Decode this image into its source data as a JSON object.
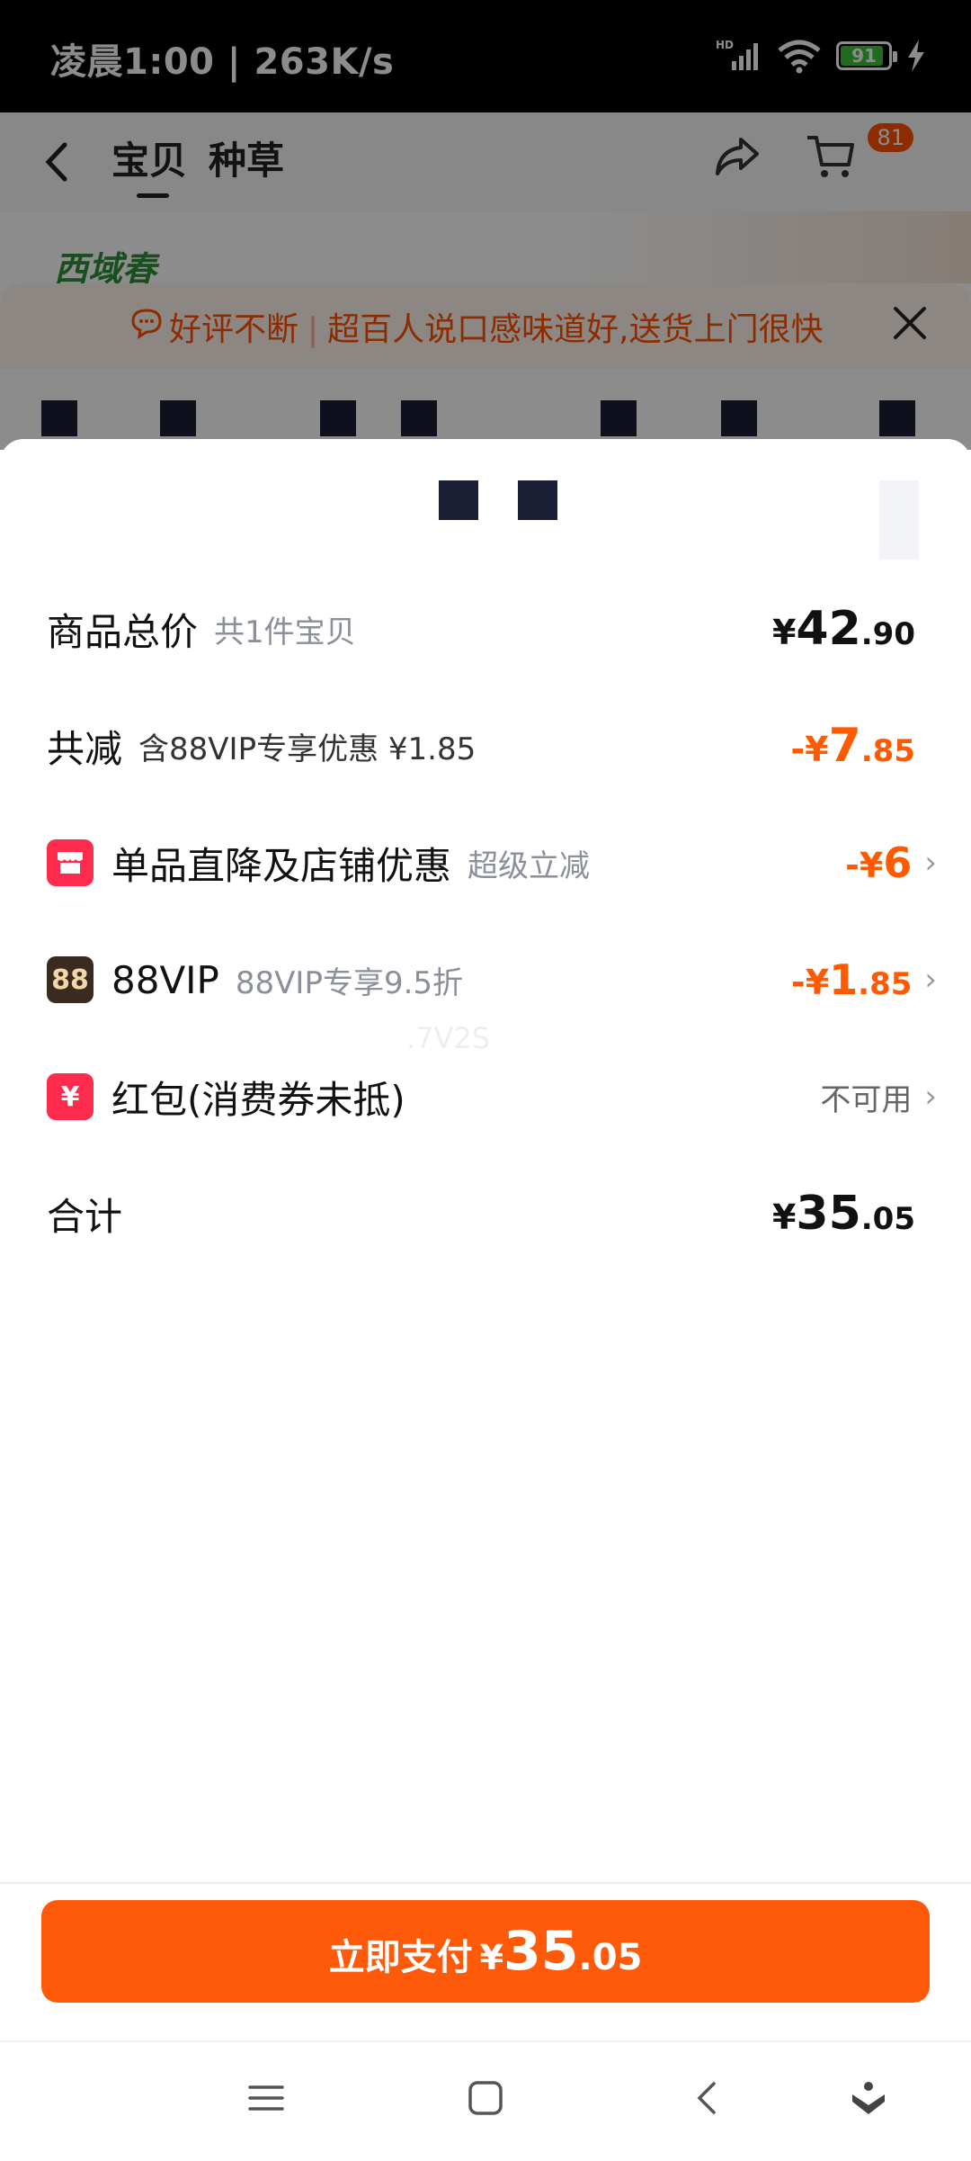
{
  "status_bar": {
    "time": "凌晨1:00 | 263K/s",
    "battery": "91",
    "battery_level": 0.91
  },
  "nav": {
    "tabs": [
      "宝贝",
      "种草"
    ],
    "cart_badge": "81"
  },
  "brand": {
    "logo_text": "西域春"
  },
  "promo": {
    "tag": "好评不断",
    "text": "超百人说口感味道好,送货上门很快"
  },
  "summary": {
    "total": {
      "label": "商品总价",
      "sub": "共1件宝贝",
      "currency": "¥",
      "int": "42",
      "dec": ".90"
    },
    "reduction": {
      "label": "共减",
      "sub": "含88VIP专享优惠 ¥1.85",
      "prefix": "-¥",
      "int": "7",
      "dec": ".85"
    },
    "items": [
      {
        "label": "单品直降及店铺优惠",
        "sub": "超级立减",
        "prefix": "-¥",
        "int": "6",
        "dec": "",
        "icon": "shop-icon"
      },
      {
        "label": "88VIP",
        "sub": "88VIP专享9.5折",
        "prefix": "-¥",
        "int": "1",
        "dec": ".85",
        "icon_text": "88",
        "icon": "vip-88-icon"
      },
      {
        "label": "红包(消费券未抵)",
        "status": "不可用",
        "icon": "red-packet-icon",
        "icon_text": "¥"
      }
    ],
    "subtotal": {
      "label": "合计",
      "currency": "¥",
      "int": "35",
      "dec": ".05"
    },
    "watermark": ".7V2S"
  },
  "pay_button": {
    "label": "立即支付",
    "currency": "¥",
    "int": "35",
    "dec": ".05"
  },
  "colors": {
    "accent": "#ff5a0a",
    "discount": "#ff5a00",
    "red_icon": "#ff2b4d",
    "vip_icon": "#3a2a1f"
  }
}
